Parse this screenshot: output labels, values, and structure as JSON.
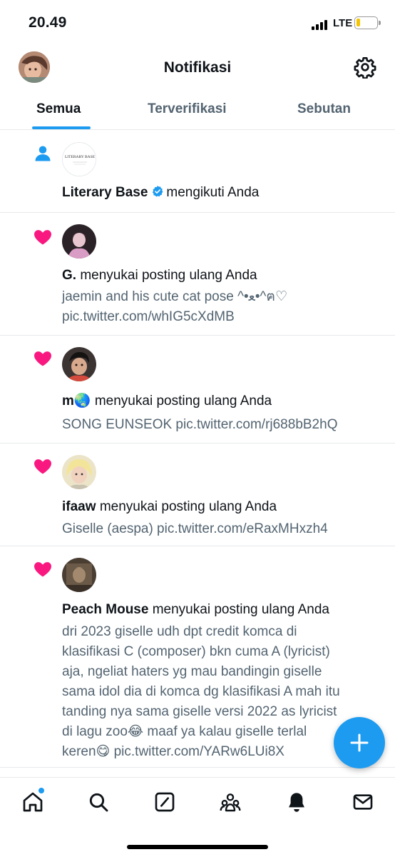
{
  "status_bar": {
    "time": "20.49",
    "network": "LTE"
  },
  "header": {
    "title": "Notifikasi"
  },
  "tabs": [
    {
      "label": "Semua",
      "active": true
    },
    {
      "label": "Terverifikasi",
      "active": false
    },
    {
      "label": "Sebutan",
      "active": false
    }
  ],
  "notifications": [
    {
      "type": "follow",
      "user": "Literary Base",
      "verified": true,
      "action": "mengikuti Anda",
      "avatar_text": "LITERARY BASE"
    },
    {
      "type": "like",
      "user": "G.",
      "action": "menyukai posting ulang Anda",
      "text_1": "jaemin and his cute cat pose ^•ﻌ•^ฅ♡",
      "text_2": "pic.twitter.com/whIG5cXdMB"
    },
    {
      "type": "like",
      "user": "m🌏",
      "action": "menyukai posting ulang Anda",
      "text_1": "SONG EUNSEOK pic.twitter.com/rj688bB2hQ"
    },
    {
      "type": "like",
      "user": "ifaaw",
      "action": "menyukai posting ulang Anda",
      "text_1": "Giselle (aespa) pic.twitter.com/eRaxMHxzh4"
    },
    {
      "type": "like",
      "user": "Peach Mouse",
      "action": "menyukai posting ulang Anda",
      "lines": [
        "dri 2023 giselle udh dpt credit komca di",
        "klasifikasi C (composer) bkn cuma A (lyricist)",
        "aja, ngeliat haters yg mau bandingin giselle",
        "sama idol dia di komca dg klasifikasi A mah itu",
        "tanding nya sama giselle versi 2022 as lyricist",
        "di lagu zoo😂 maaf ya kalau giselle terlal",
        "keren😋 pic.twitter.com/YARw6LUi8X"
      ]
    }
  ],
  "colors": {
    "accent": "#1d9bf0",
    "like": "#f91880",
    "secondary_text": "#536471"
  },
  "icons": [
    "settings-icon",
    "person-icon",
    "heart-icon",
    "verified-icon",
    "compose-icon",
    "home-icon",
    "search-icon",
    "grok-icon",
    "communities-icon",
    "notifications-icon",
    "messages-icon"
  ]
}
